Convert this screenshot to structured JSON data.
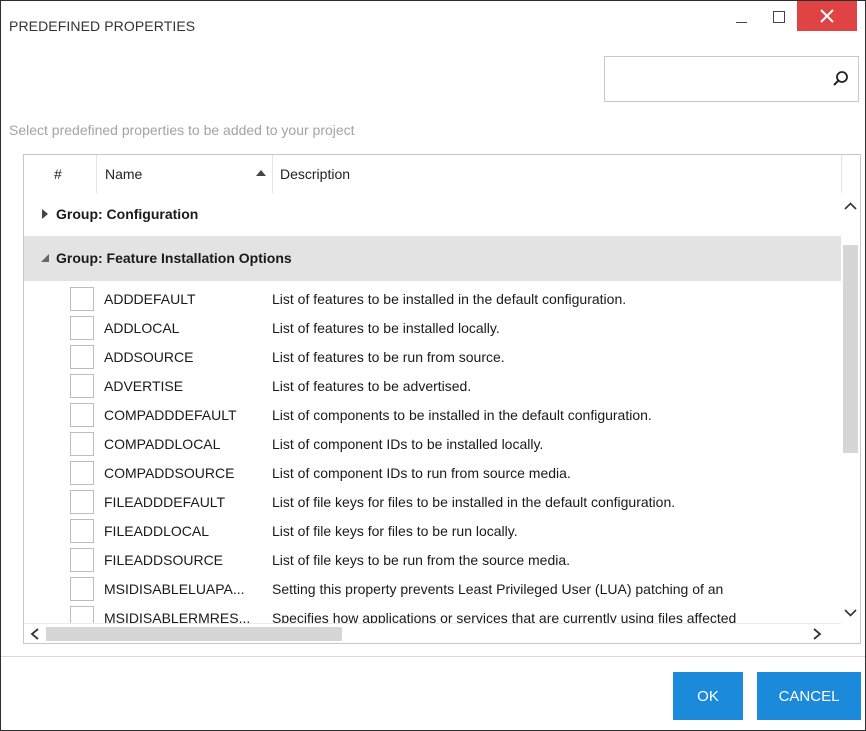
{
  "window": {
    "title": "PREDEFINED PROPERTIES"
  },
  "search": {
    "value": "",
    "placeholder": ""
  },
  "instruction": "Select predefined properties to be added to your project",
  "grid": {
    "columns": {
      "index": "#",
      "name": "Name",
      "description": "Description"
    },
    "sorted_column": "Name",
    "sort_direction": "ascending",
    "groups": [
      {
        "label": "Group: Configuration",
        "expanded": false
      },
      {
        "label": "Group: Feature Installation Options",
        "expanded": true
      }
    ],
    "rows": [
      {
        "name": "ADDDEFAULT",
        "description": "List of features to be installed in the default configuration.",
        "checked": false
      },
      {
        "name": "ADDLOCAL",
        "description": "List of features to be installed locally.",
        "checked": false
      },
      {
        "name": "ADDSOURCE",
        "description": "List of features to be run from source.",
        "checked": false
      },
      {
        "name": "ADVERTISE",
        "description": "List of features to be advertised.",
        "checked": false
      },
      {
        "name": "COMPADDDEFAULT",
        "description": "List of components to be installed in the default configuration.",
        "checked": false
      },
      {
        "name": "COMPADDLOCAL",
        "description": "List of component IDs to be installed locally.",
        "checked": false
      },
      {
        "name": "COMPADDSOURCE",
        "description": "List of component IDs to run from source media.",
        "checked": false
      },
      {
        "name": "FILEADDDEFAULT",
        "description": "List of file keys for files to be installed in the default configuration.",
        "checked": false
      },
      {
        "name": "FILEADDLOCAL",
        "description": "List of file keys for files to be run locally.",
        "checked": false
      },
      {
        "name": "FILEADDSOURCE",
        "description": "List of file keys to be run from the source media.",
        "checked": false
      },
      {
        "name": "MSIDISABLELUAPA...",
        "description": "Setting this property prevents Least Privileged User (LUA) patching of an",
        "checked": false
      },
      {
        "name": "MSIDISABLERMRES...",
        "description": "Specifies how applications or services that are currently using files affected",
        "checked": false
      }
    ]
  },
  "buttons": {
    "ok": "OK",
    "cancel": "CANCEL"
  },
  "colors": {
    "accent": "#1c8adb",
    "close": "#e04343",
    "group_expanded_bg": "#e3e3e3",
    "instruction_text": "#a3a3a3"
  },
  "icons": {
    "search": "search-icon",
    "minimize": "minimize-icon",
    "maximize": "maximize-icon",
    "close": "close-icon",
    "sort": "sort-up-icon",
    "group_collapsed": "caret-right-icon",
    "group_expanded": "caret-down-icon"
  }
}
